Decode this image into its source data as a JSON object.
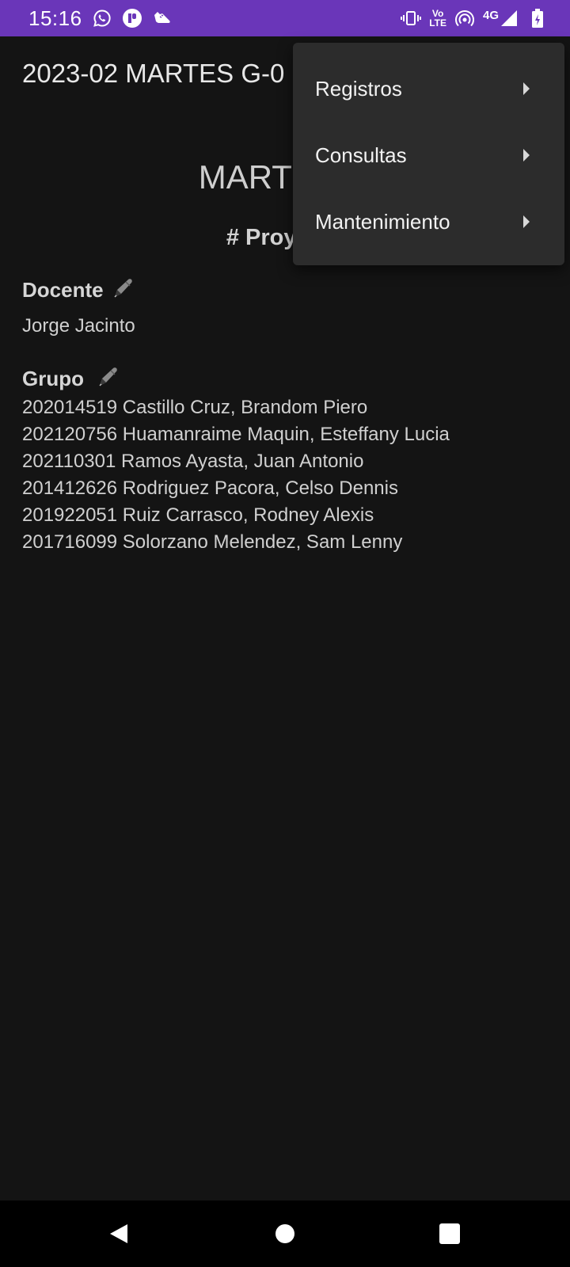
{
  "status_bar": {
    "time": "15:16",
    "left_icons": [
      "whatsapp-icon",
      "app-notification-icon",
      "shoe-icon"
    ],
    "right_icons": [
      "vibrate-icon",
      "volte-icon",
      "hotspot-icon",
      "signal-icon",
      "battery-icon"
    ],
    "volte_top": "Vo",
    "volte_bottom": "LTE",
    "network_type": "4G",
    "background": "#6a36b9"
  },
  "app_bar": {
    "title": "2023-02 MARTES G-0"
  },
  "content": {
    "heading": "MARTES G",
    "project_heading": "# Proyecto",
    "teacher_section": {
      "label": "Docente",
      "icon": "pen-icon",
      "name": "Jorge Jacinto"
    },
    "group_section": {
      "label": "Grupo",
      "icon": "pen-icon",
      "members": [
        "202014519 Castillo Cruz, Brandom Piero",
        "202120756 Huamanraime Maquin, Esteffany Lucia",
        "202110301 Ramos Ayasta, Juan Antonio",
        "201412626 Rodriguez Pacora, Celso Dennis",
        "201922051 Ruiz Carrasco, Rodney Alexis",
        "201716099 Solorzano Melendez, Sam Lenny"
      ]
    }
  },
  "overflow_menu": {
    "items": [
      {
        "label": "Registros",
        "icon": "submenu-arrow-icon"
      },
      {
        "label": "Consultas",
        "icon": "submenu-arrow-icon"
      },
      {
        "label": "Mantenimiento",
        "icon": "submenu-arrow-icon"
      }
    ]
  },
  "nav_bar": {
    "buttons": [
      "back-icon",
      "home-icon",
      "recents-icon"
    ]
  }
}
